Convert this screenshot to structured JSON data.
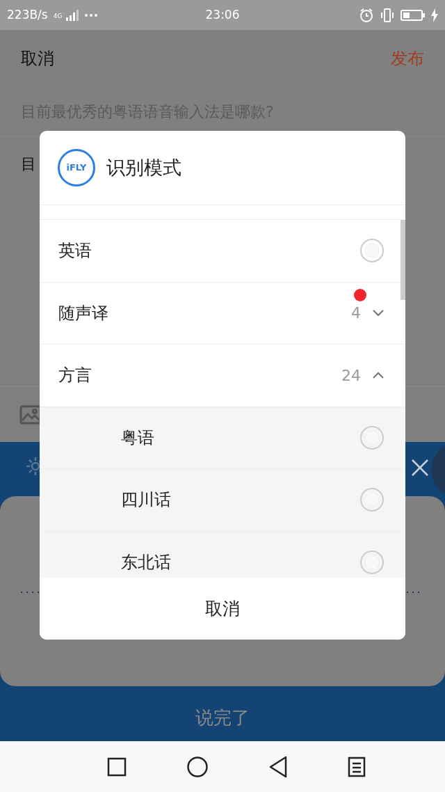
{
  "status_bar": {
    "speed": "223B/s",
    "network": "4G",
    "time": "23:06"
  },
  "top_bar": {
    "cancel": "取消",
    "publish": "发布"
  },
  "question_title": "目前最优秀的粤语语音输入法是哪款?",
  "body_text": "目",
  "voice_panel": {
    "done_button": "说完了"
  },
  "dialog": {
    "logo_text": "iFLY",
    "title": "识别模式",
    "modes": [
      {
        "label": "英语",
        "kind": "radio",
        "selected": false
      },
      {
        "label": "随声译",
        "kind": "group",
        "count": "4",
        "has_new": true,
        "expanded": false
      },
      {
        "label": "方言",
        "kind": "group",
        "count": "24",
        "has_new": false,
        "expanded": true,
        "children": [
          {
            "label": "粤语",
            "selected": false
          },
          {
            "label": "四川话",
            "selected": false
          },
          {
            "label": "东北话",
            "selected": false
          }
        ]
      }
    ],
    "cancel": "取消"
  }
}
